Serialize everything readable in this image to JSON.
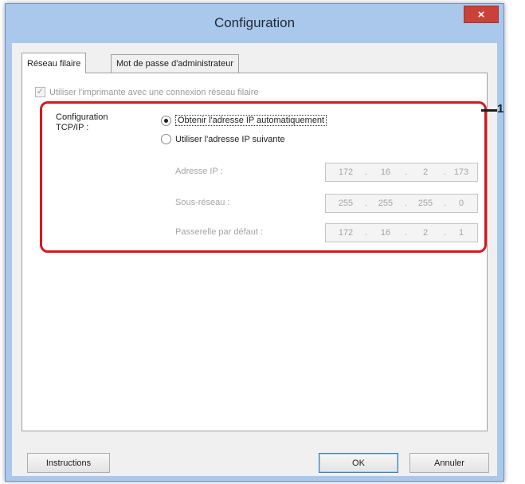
{
  "window": {
    "title": "Configuration",
    "close_glyph": "×"
  },
  "tabs": [
    {
      "label": "Réseau filaire",
      "active": true
    },
    {
      "label": "Mot de passe d'administrateur",
      "active": false
    }
  ],
  "wired_checkbox": {
    "label": "Utiliser l'imprimante avec une connexion réseau filaire",
    "checked": true,
    "enabled": false,
    "check_glyph": "✓"
  },
  "tcpip": {
    "label_line1": "Configuration",
    "label_line2": "TCP/IP :",
    "option_auto": "Obtenir l'adresse IP automatiquement",
    "option_manual": "Utiliser l'adresse IP suivante",
    "selected": "auto"
  },
  "fields": {
    "ip_label": "Adresse IP :",
    "ip": [
      "172",
      "16",
      "2",
      "173"
    ],
    "subnet_label": "Sous-réseau :",
    "subnet": [
      "255",
      "255",
      "255",
      "0"
    ],
    "gateway_label": "Passerelle par défaut :",
    "gateway": [
      "172",
      "16",
      "2",
      "1"
    ]
  },
  "annotation": {
    "number": "1",
    "color": "#d8181c"
  },
  "buttons": {
    "instructions": "Instructions",
    "ok": "OK",
    "cancel": "Annuler"
  },
  "colors": {
    "title_bar": "#a9c8ec",
    "close_button": "#c9423a",
    "highlight_border": "#d8181c"
  },
  "icons": {
    "close": "close-icon",
    "checkbox": "checkmark-icon",
    "radio": "radio-dot-icon"
  }
}
